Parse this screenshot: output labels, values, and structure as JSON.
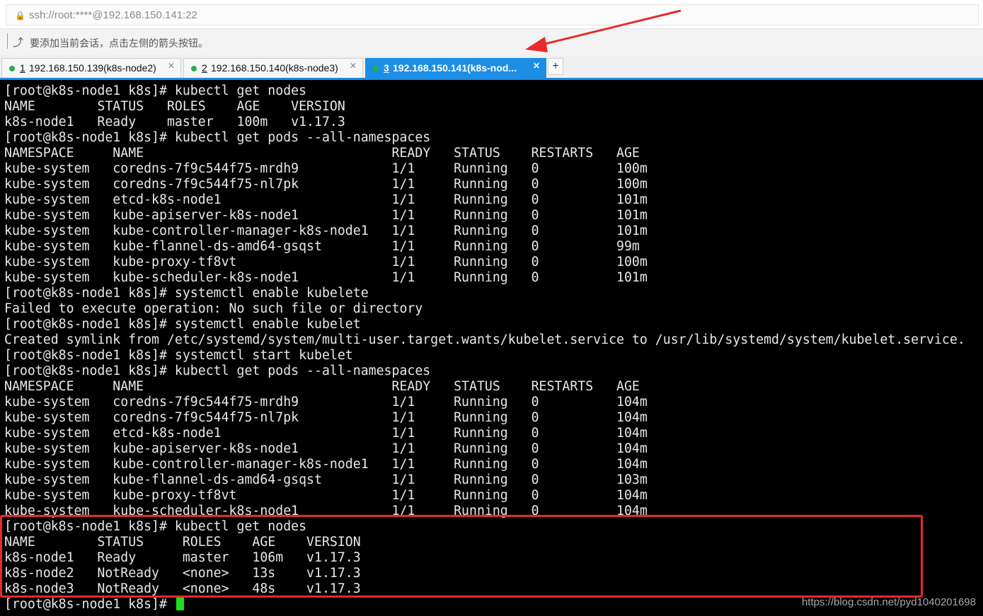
{
  "address_bar": {
    "url": "ssh://root:****@192.168.150.141:22"
  },
  "hint_bar": {
    "text": "要添加当前会话，点击左侧的箭头按钮。"
  },
  "tabs": [
    {
      "num": "1",
      "label": "192.168.150.139(k8s-node2)",
      "active": false
    },
    {
      "num": "2",
      "label": "192.168.150.140(k8s-node3)",
      "active": false
    },
    {
      "num": "3",
      "label": "192.168.150.141(k8s-nod...",
      "active": true
    }
  ],
  "new_tab": "+",
  "terminal": {
    "lines": [
      "[root@k8s-node1 k8s]# kubectl get nodes",
      "NAME        STATUS   ROLES    AGE    VERSION",
      "k8s-node1   Ready    master   100m   v1.17.3",
      "[root@k8s-node1 k8s]# kubectl get pods --all-namespaces",
      "NAMESPACE     NAME                                READY   STATUS    RESTARTS   AGE",
      "kube-system   coredns-7f9c544f75-mrdh9            1/1     Running   0          100m",
      "kube-system   coredns-7f9c544f75-nl7pk            1/1     Running   0          100m",
      "kube-system   etcd-k8s-node1                      1/1     Running   0          101m",
      "kube-system   kube-apiserver-k8s-node1            1/1     Running   0          101m",
      "kube-system   kube-controller-manager-k8s-node1   1/1     Running   0          101m",
      "kube-system   kube-flannel-ds-amd64-gsqst         1/1     Running   0          99m",
      "kube-system   kube-proxy-tf8vt                    1/1     Running   0          100m",
      "kube-system   kube-scheduler-k8s-node1            1/1     Running   0          101m",
      "[root@k8s-node1 k8s]# systemctl enable kubelete",
      "Failed to execute operation: No such file or directory",
      "[root@k8s-node1 k8s]# systemctl enable kubelet",
      "Created symlink from /etc/systemd/system/multi-user.target.wants/kubelet.service to /usr/lib/systemd/system/kubelet.service.",
      "[root@k8s-node1 k8s]# systemctl start kubelet",
      "[root@k8s-node1 k8s]# kubectl get pods --all-namespaces",
      "NAMESPACE     NAME                                READY   STATUS    RESTARTS   AGE",
      "kube-system   coredns-7f9c544f75-mrdh9            1/1     Running   0          104m",
      "kube-system   coredns-7f9c544f75-nl7pk            1/1     Running   0          104m",
      "kube-system   etcd-k8s-node1                      1/1     Running   0          104m",
      "kube-system   kube-apiserver-k8s-node1            1/1     Running   0          104m",
      "kube-system   kube-controller-manager-k8s-node1   1/1     Running   0          104m",
      "kube-system   kube-flannel-ds-amd64-gsqst         1/1     Running   0          103m",
      "kube-system   kube-proxy-tf8vt                    1/1     Running   0          104m",
      "kube-system   kube-scheduler-k8s-node1            1/1     Running   0          104m",
      "[root@k8s-node1 k8s]# kubectl get nodes",
      "NAME        STATUS     ROLES    AGE    VERSION",
      "k8s-node1   Ready      master   106m   v1.17.3",
      "k8s-node2   NotReady   <none>   13s    v1.17.3",
      "k8s-node3   NotReady   <none>   48s    v1.17.3",
      "[root@k8s-node1 k8s]# "
    ]
  },
  "watermark": "https://blog.csdn.net/pyd1040201698",
  "colors": {
    "accent": "#1c8ee6",
    "highlight_box": "#e82a2a",
    "cursor": "#1ee01e",
    "annotation_arrow": "#e82a2a"
  }
}
